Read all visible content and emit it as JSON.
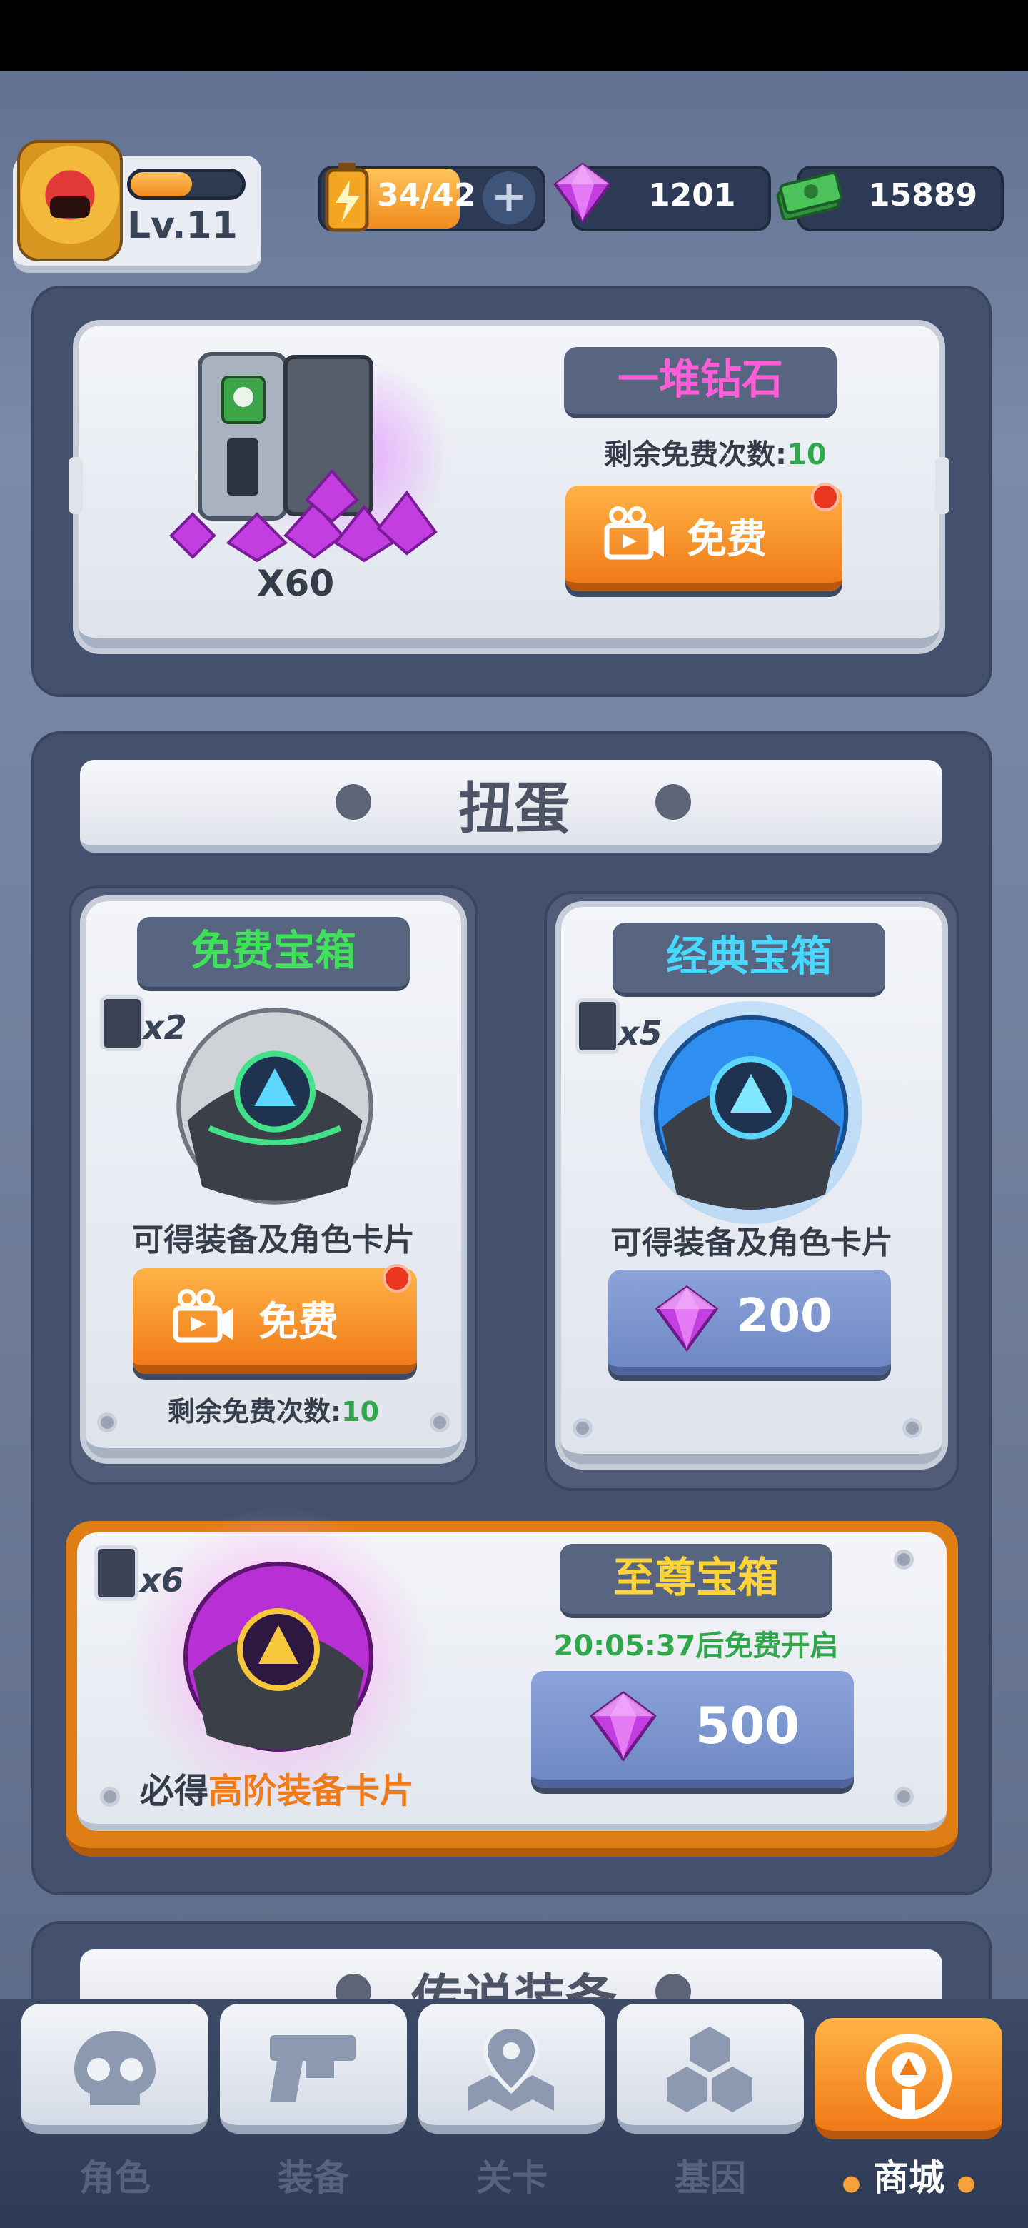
{
  "player": {
    "level": "Lv.11",
    "xp_fraction": 0.55
  },
  "resources": {
    "energy": "34/42",
    "plus": "+",
    "gems": "1201",
    "cash": "15889"
  },
  "gem_pile": {
    "title": "一堆钻石",
    "remaining_prefix": "剩余免费次数:",
    "remaining_value": "10",
    "quantity": "X60",
    "button_label": "免费"
  },
  "gacha": {
    "section_title": "扭蛋",
    "free_chest": {
      "title": "免费宝箱",
      "title_color": "#3fe05a",
      "multiplier": "x2",
      "desc": "可得装备及角色卡片",
      "button_label": "免费",
      "remaining_prefix": "剩余免费次数:",
      "remaining_value": "10"
    },
    "classic_chest": {
      "title": "经典宝箱",
      "title_color": "#46d8ff",
      "multiplier": "x5",
      "desc": "可得装备及角色卡片",
      "price": "200"
    },
    "supreme_chest": {
      "title": "至尊宝箱",
      "title_color": "#ffd43b",
      "multiplier": "x6",
      "timer": "20:05:37后免费开启",
      "desc_prefix": "必得",
      "desc_highlight": "高阶装备卡片",
      "price": "500"
    }
  },
  "next_section": {
    "title": "传说装备"
  },
  "nav": {
    "items": [
      {
        "label": "角色",
        "icon": "skull-icon"
      },
      {
        "label": "装备",
        "icon": "gun-icon"
      },
      {
        "label": "关卡",
        "icon": "map-pin-icon"
      },
      {
        "label": "基因",
        "icon": "hexagons-icon"
      },
      {
        "label": "商城",
        "icon": "shop-icon"
      }
    ]
  }
}
